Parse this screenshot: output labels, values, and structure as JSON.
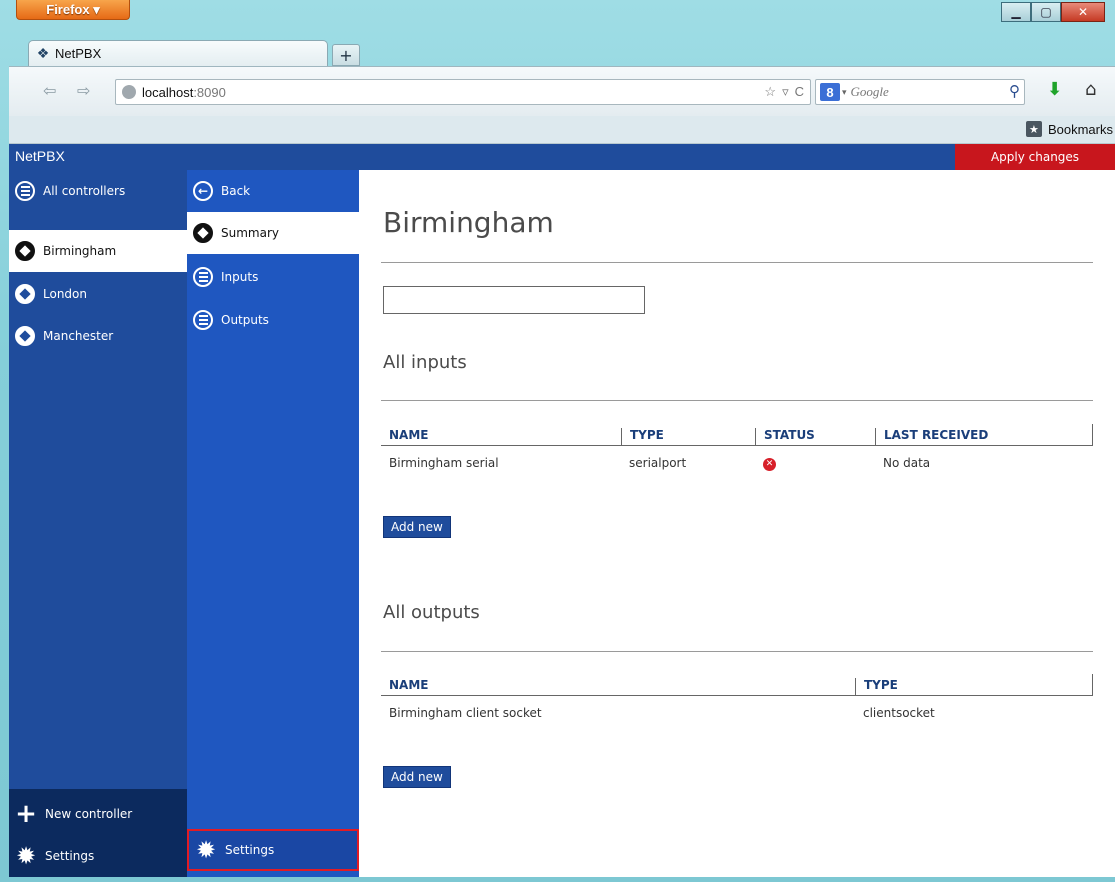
{
  "browser": {
    "menu_label": "Firefox ▾",
    "tab_title": "NetPBX",
    "new_tab": "+",
    "url_host": "localhost",
    "url_port": ":8090",
    "search_placeholder": "Google",
    "bookmarks_label": "Bookmarks"
  },
  "app": {
    "title": "NetPBX",
    "apply_label": "Apply changes",
    "accent_color": "#1f4c9c",
    "apply_color": "#c8161d"
  },
  "sidebar": {
    "all_controllers": "All controllers",
    "controllers": [
      {
        "label": "Birmingham",
        "active": true
      },
      {
        "label": "London",
        "active": false
      },
      {
        "label": "Manchester",
        "active": false
      }
    ],
    "new_controller": "New controller",
    "settings": "Settings"
  },
  "subnav": {
    "back": "Back",
    "summary": "Summary",
    "inputs": "Inputs",
    "outputs": "Outputs",
    "settings": "Settings"
  },
  "main": {
    "title": "Birmingham",
    "filter_value": "",
    "inputs": {
      "heading": "All inputs",
      "columns": [
        "NAME",
        "TYPE",
        "STATUS",
        "LAST RECEIVED"
      ],
      "rows": [
        {
          "name": "Birmingham serial",
          "type": "serialport",
          "status": "error",
          "last_received": "No data"
        }
      ],
      "add_label": "Add new"
    },
    "outputs": {
      "heading": "All outputs",
      "columns": [
        "NAME",
        "TYPE"
      ],
      "rows": [
        {
          "name": "Birmingham client socket",
          "type": "clientsocket"
        }
      ],
      "add_label": "Add new"
    }
  }
}
